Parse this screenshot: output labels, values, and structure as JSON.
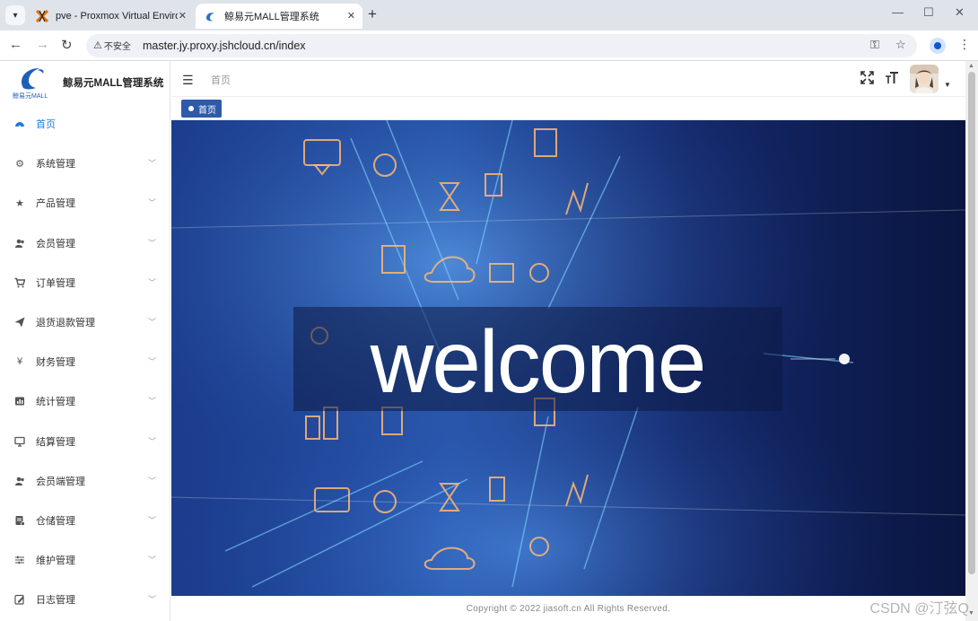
{
  "browser": {
    "tabs": [
      {
        "title": "pve - Proxmox Virtual Environment",
        "icon": "proxmox-icon"
      },
      {
        "title": "鲸易元MALL管理系统",
        "icon": "whale-icon"
      }
    ],
    "address": {
      "security_label": "不安全",
      "url": "master.jy.proxy.jshcloud.cn/index"
    }
  },
  "app": {
    "logo_subtitle": "鲸易元MALL",
    "system_title": "鲸易元MALL管理系统",
    "menu": [
      {
        "label": "首页",
        "icon": "dashboard-icon",
        "active": true
      },
      {
        "label": "系统管理",
        "icon": "gear-icon"
      },
      {
        "label": "产品管理",
        "icon": "star-icon"
      },
      {
        "label": "会员管理",
        "icon": "users-icon"
      },
      {
        "label": "订单管理",
        "icon": "cart-icon"
      },
      {
        "label": "退货退款管理",
        "icon": "send-icon"
      },
      {
        "label": "财务管理",
        "icon": "yen-icon"
      },
      {
        "label": "统计管理",
        "icon": "chart-icon"
      },
      {
        "label": "结算管理",
        "icon": "monitor-icon"
      },
      {
        "label": "会员端管理",
        "icon": "user-group-icon"
      },
      {
        "label": "仓储管理",
        "icon": "warehouse-icon"
      },
      {
        "label": "维护管理",
        "icon": "sliders-icon"
      },
      {
        "label": "日志管理",
        "icon": "edit-icon"
      }
    ],
    "breadcrumb": "首页",
    "active_tag": "首页",
    "banner_text": "welcome",
    "footer": "Copyright © 2022 jiasoft.cn All Rights Reserved."
  },
  "watermark": "CSDN @汀弦Q",
  "colors": {
    "accent": "#1e7bd6",
    "tag_bg": "#2f5aa9",
    "banner_dark": "#0b1a4a"
  }
}
